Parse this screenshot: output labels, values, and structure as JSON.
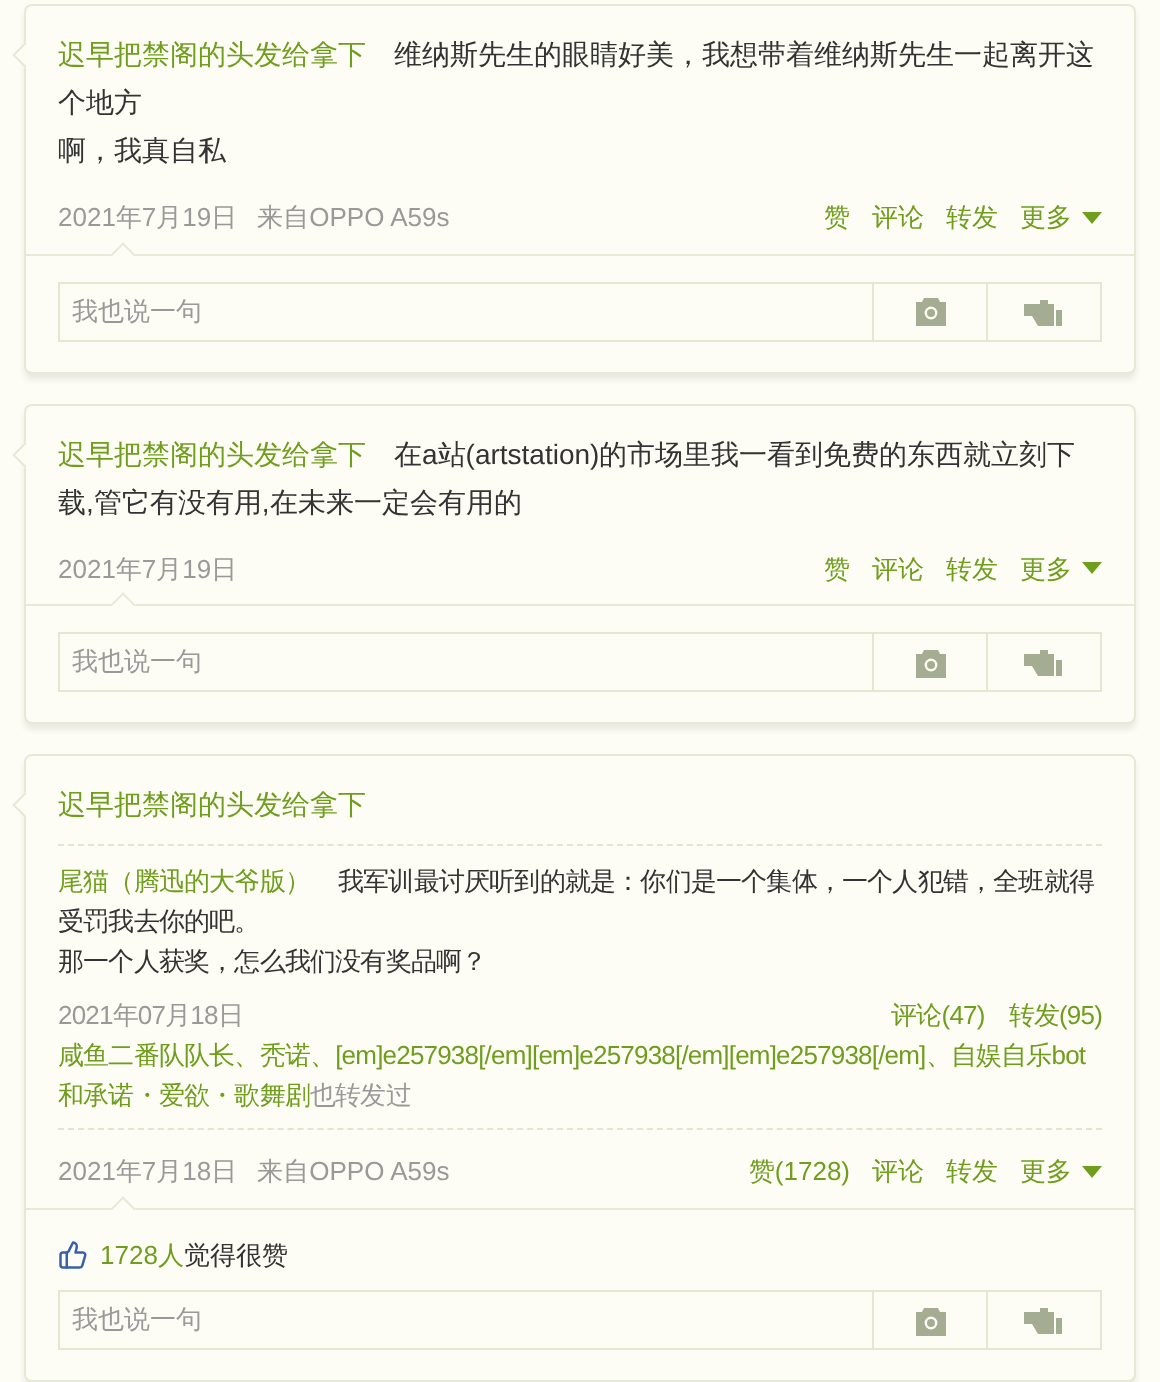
{
  "posts": [
    {
      "kind": "post",
      "author": "迟早把禁阁的头发给拿下",
      "lines": [
        "维纳斯先生的眼睛好美，我想带着维纳斯先生一起离开这个地方",
        "啊，我真自私"
      ],
      "date": "2021年7月19日",
      "source": "来自OPPO A59s",
      "actions": [
        {
          "kind": "link",
          "label": "赞"
        },
        {
          "kind": "link",
          "label": "评论"
        },
        {
          "kind": "link",
          "label": "转发"
        },
        {
          "kind": "menu",
          "label": "更多"
        }
      ],
      "reply": {
        "placeholder": "我也说一句"
      }
    },
    {
      "kind": "post",
      "author": "迟早把禁阁的头发给拿下",
      "lines": [
        "在a站(artstation)的市场里我一看到免费的东西就立刻下载,管它有没有用,在未来一定会有用的"
      ],
      "date": "2021年7月19日",
      "actions": [
        {
          "kind": "link",
          "label": "赞"
        },
        {
          "kind": "link",
          "label": "评论"
        },
        {
          "kind": "link",
          "label": "转发"
        },
        {
          "kind": "menu",
          "label": "更多"
        }
      ],
      "reply": {
        "placeholder": "我也说一句"
      }
    },
    {
      "kind": "repost",
      "author": "迟早把禁阁的头发给拿下",
      "original": {
        "author": "尾猫（腾迅的大爷版）",
        "lines": [
          "我军训最讨厌听到的就是：你们是一个集体，一个人犯错，全班就得受罚我去你的吧。",
          "那一个人获奖，怎么我们没有奖品啊？"
        ],
        "date": "2021年07月18日",
        "stats": [
          "评论(47)",
          "转发(95)"
        ],
        "forwarders": "咸鱼二番队队长、秃诺、[em]e257938[/em][em]e257938[/em][em]e257938[/em]、自娱自乐bot和承诺・爱欲・歌舞剧",
        "forwarded_suffix": "也转发过"
      },
      "date": "2021年7月18日",
      "source": "来自OPPO A59s",
      "actions": [
        {
          "kind": "link",
          "label": "赞(1728)"
        },
        {
          "kind": "link",
          "label": "评论"
        },
        {
          "kind": "link",
          "label": "转发"
        },
        {
          "kind": "menu",
          "label": "更多"
        }
      ],
      "likes": {
        "count": "1728人",
        "suffix": "觉得很赞"
      },
      "reply": {
        "placeholder": "我也说一句"
      }
    }
  ]
}
